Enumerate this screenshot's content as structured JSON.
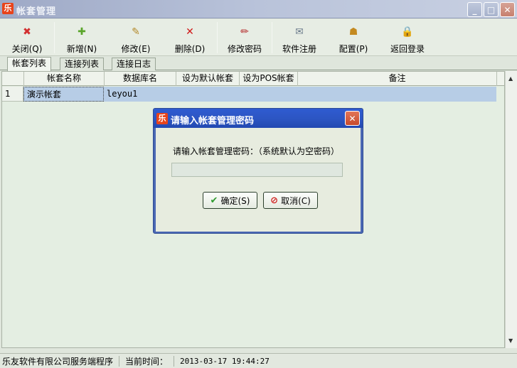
{
  "window": {
    "app_icon": "乐",
    "title": "帐套管理"
  },
  "window_controls": {
    "minimize": "_",
    "maximize": "□",
    "close": "✕"
  },
  "toolbar": [
    {
      "id": "close",
      "icon": "close-icon",
      "glyph": "✖",
      "color": "#d23030",
      "label": "关闭(Q)"
    },
    {
      "id": "add",
      "icon": "add-icon",
      "glyph": "✚",
      "color": "#5aa52a",
      "label": "新增(N)"
    },
    {
      "id": "edit",
      "icon": "edit-icon",
      "glyph": "✎",
      "color": "#b48a2a",
      "label": "修改(E)"
    },
    {
      "id": "delete",
      "icon": "delete-icon",
      "glyph": "✕",
      "color": "#d01818",
      "label": "删除(D)"
    },
    {
      "id": "change-password",
      "icon": "pen-icon",
      "glyph": "✏",
      "color": "#b42a2a",
      "label": "修改密码"
    },
    {
      "id": "register",
      "icon": "envelope-icon",
      "glyph": "✉",
      "color": "#6c7c8c",
      "label": "软件注册"
    },
    {
      "id": "config",
      "icon": "config-icon",
      "glyph": "☗",
      "color": "#c48a20",
      "label": "配置(P)"
    },
    {
      "id": "relogin",
      "icon": "lock-icon",
      "glyph": "🔒",
      "color": "#d8b020",
      "label": "返回登录"
    }
  ],
  "tabs": [
    "帐套列表",
    "连接列表",
    "连接日志"
  ],
  "grid": {
    "columns": [
      "帐套名称",
      "数据库名",
      "设为默认帐套",
      "设为POS帐套",
      "备注"
    ],
    "rows": [
      {
        "num": "1",
        "name": "演示帐套",
        "db": "leyou1",
        "default": "",
        "pos": "",
        "note": ""
      }
    ]
  },
  "dialog": {
    "app_icon": "乐",
    "title": "请输入帐套管理密码",
    "prompt": "请输入帐套管理密码：（系统默认为空密码）",
    "password_value": "",
    "ok_icon": "✔",
    "ok_label": "确定(S)",
    "cancel_icon": "⊘",
    "cancel_label": "取消(C)",
    "close": "✕"
  },
  "status": {
    "app": "乐友软件有限公司服务端程序",
    "time_label": "当前时间：",
    "time_value": "2013-03-17 19:44:27"
  }
}
